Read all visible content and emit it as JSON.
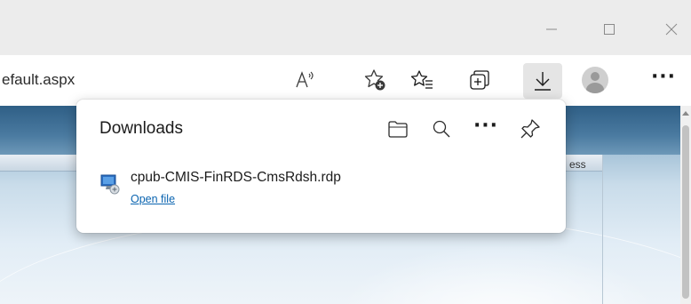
{
  "window_controls": {
    "minimize_icon": "minimize-icon",
    "maximize_icon": "maximize-icon",
    "close_icon": "close-icon"
  },
  "address_bar": {
    "url_text": "efault.aspx"
  },
  "toolbar": {
    "icons": [
      "read-aloud-icon",
      "add-favorite-icon",
      "favorites-icon",
      "collections-icon",
      "downloads-icon",
      "profile-icon",
      "more-icon"
    ],
    "read_aloud_label": "A",
    "more_label": "···"
  },
  "page": {
    "partial_nav_text": "ess"
  },
  "downloads": {
    "title": "Downloads",
    "header_icons": [
      "open-folder-icon",
      "search-icon",
      "more-icon",
      "pin-icon"
    ],
    "more_label": "···",
    "items": [
      {
        "file_name": "cpub-CMIS-FinRDS-CmsRdsh.rdp",
        "action_label": "Open file",
        "icon": "rdp-file-icon"
      }
    ]
  },
  "colors": {
    "titlebar": "#ececec",
    "link": "#0a64b0",
    "downloads_button_bg": "#e5e5e5",
    "page_header": "#2f5f86"
  }
}
